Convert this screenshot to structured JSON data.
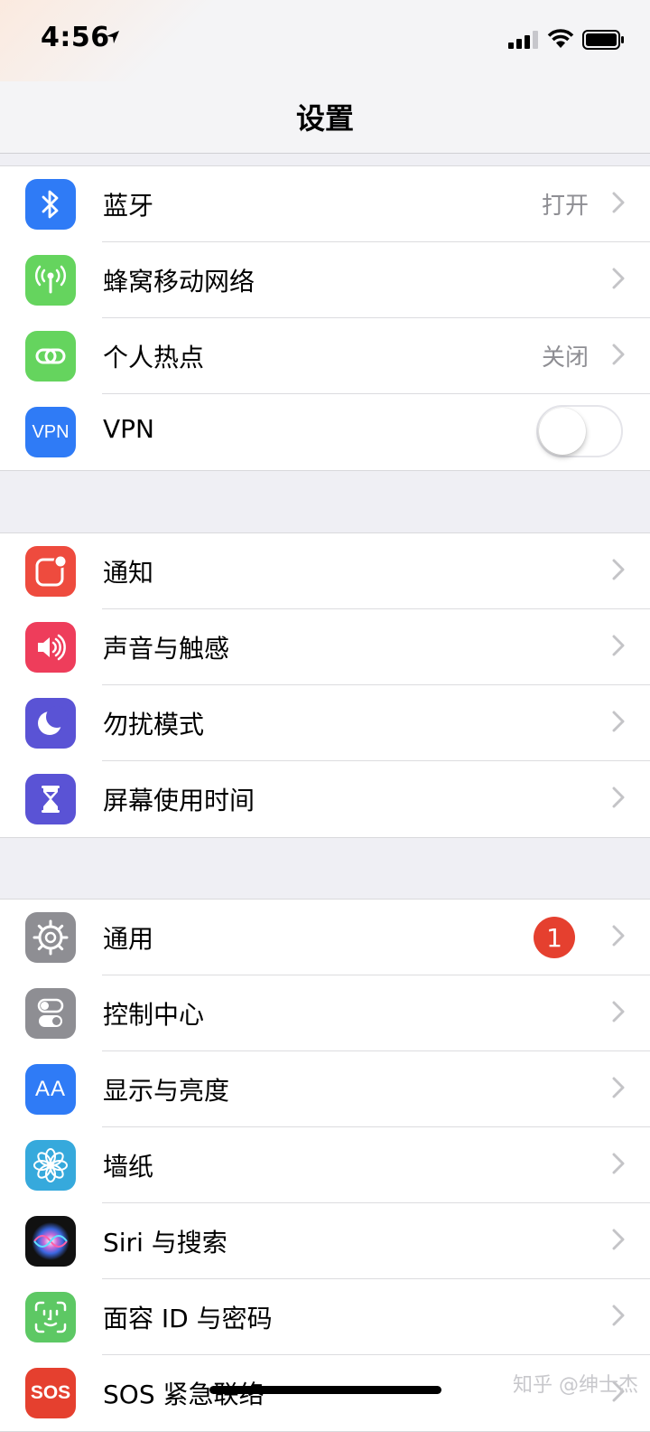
{
  "status": {
    "time": "4:56"
  },
  "nav": {
    "title": "设置"
  },
  "groups": [
    {
      "items": [
        {
          "label": "蓝牙",
          "value": "打开",
          "icon": "bluetooth-icon",
          "color": "#2f7bf6"
        },
        {
          "label": "蜂窝移动网络",
          "value": "",
          "icon": "cellular-antenna-icon",
          "color": "#65d45e"
        },
        {
          "label": "个人热点",
          "value": "关闭",
          "icon": "hotspot-link-icon",
          "color": "#65d45e"
        },
        {
          "label": "VPN",
          "value": "",
          "icon": "vpn-icon",
          "icon_text": "VPN",
          "color": "#2f7bf6",
          "toggle": "off"
        }
      ]
    },
    {
      "items": [
        {
          "label": "通知",
          "icon": "notification-icon",
          "color": "#ee4b3e"
        },
        {
          "label": "声音与触感",
          "icon": "speaker-icon",
          "color": "#ee3d5b"
        },
        {
          "label": "勿扰模式",
          "icon": "moon-icon",
          "color": "#5a53d5"
        },
        {
          "label": "屏幕使用时间",
          "icon": "hourglass-icon",
          "color": "#5a53d5"
        }
      ]
    },
    {
      "items": [
        {
          "label": "通用",
          "icon": "gear-icon",
          "color": "#8e8e93",
          "badge": "1"
        },
        {
          "label": "控制中心",
          "icon": "control-toggles-icon",
          "color": "#8e8e93"
        },
        {
          "label": "显示与亮度",
          "icon": "text-size-icon",
          "icon_text": "AA",
          "color": "#2f7bf6"
        },
        {
          "label": "墙纸",
          "icon": "flower-icon",
          "color": "#36a9dc"
        },
        {
          "label": "Siri 与搜索",
          "icon": "siri-icon",
          "color": "#111111"
        },
        {
          "label": "面容 ID 与密码",
          "icon": "face-id-icon",
          "color": "#5dc864"
        },
        {
          "label": "SOS 紧急联络",
          "icon": "sos-icon",
          "icon_text": "SOS",
          "color": "#e5402f"
        }
      ]
    }
  ],
  "watermark": "知乎 @绅士杰"
}
